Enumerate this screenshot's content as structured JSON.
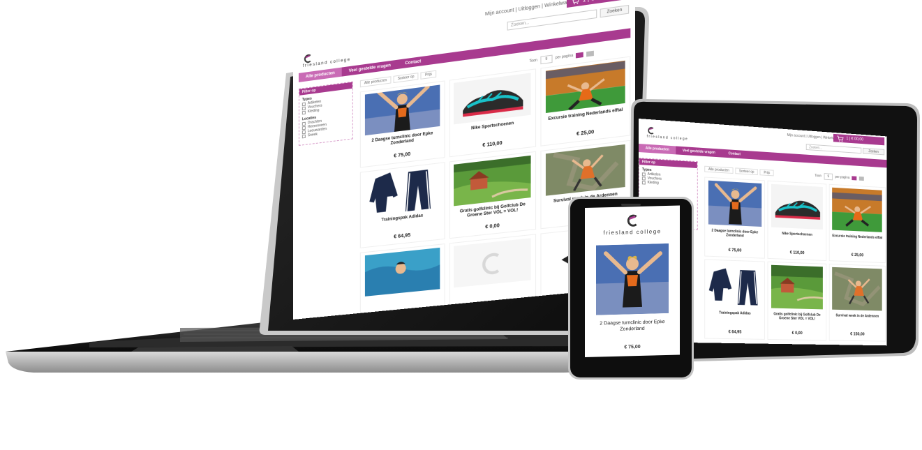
{
  "brand": {
    "name": "friesland college",
    "accent": "#a83a8f",
    "accent_light": "#c96bb5"
  },
  "header": {
    "account_text": "Mijn account | Uitloggen | Winkelwagen",
    "search_placeholder": "Zoeken...",
    "search_button": "Zoeken",
    "cart_label": "1 | € 00,00",
    "cart_icon": "cart-icon"
  },
  "nav": {
    "items": [
      {
        "label": "Alle producten"
      },
      {
        "label": "Veel gestelde vragen"
      },
      {
        "label": "Contact"
      }
    ]
  },
  "sidebar": {
    "title": "Filter op",
    "groups": [
      {
        "title": "Types",
        "options": [
          "Artikelen",
          "Vouchers",
          "Kleding"
        ]
      },
      {
        "title": "Locaties",
        "options": [
          "Drachten",
          "Heerenveen",
          "Leeuwarden",
          "Sneek"
        ]
      }
    ]
  },
  "toolbar": {
    "tabs": [
      "Alle producten",
      "Sorteer op",
      "Prijs"
    ],
    "per_page_label": "Toon",
    "per_page_value": "9",
    "per_page_suffix": "per pagina"
  },
  "products": [
    {
      "name": "2 Daagse turnclinic door Epke Zonderland",
      "price": "€ 75,00",
      "image": "gymnast"
    },
    {
      "name": "Nike Sportschoenen",
      "price": "€ 110,00",
      "image": "shoe"
    },
    {
      "name": "Excursie training Nederlands elftal",
      "price": "€ 25,00",
      "image": "football"
    },
    {
      "name": "Trainingspak Adidas",
      "price": "€ 64,95",
      "image": "tracksuit"
    },
    {
      "name": "Gratis golfclinic bij Golfclub De Groene Ster VOL = VOL!",
      "price": "€ 0,00",
      "image": "golf"
    },
    {
      "name": "Survival week in de Ardennen",
      "price": "€ 150,00",
      "image": "climb"
    },
    {
      "name": "",
      "price": "",
      "image": "swim"
    },
    {
      "name": "",
      "price": "",
      "image": "blank"
    },
    {
      "name": "",
      "price": "",
      "image": "flag"
    }
  ],
  "phone_product": {
    "name": "2 Daagse turnclinic door Epke Zonderland",
    "price": "€ 75,00"
  }
}
